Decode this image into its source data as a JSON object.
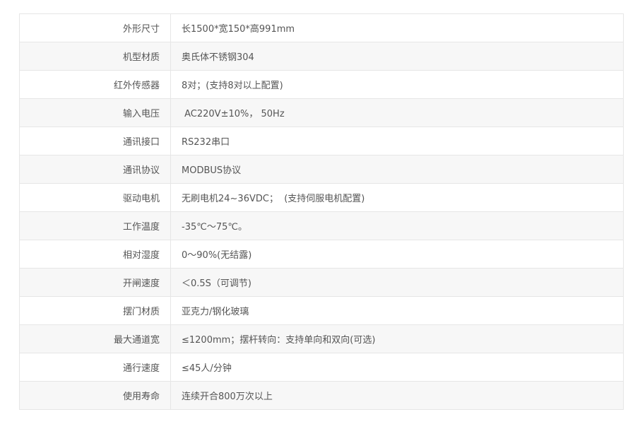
{
  "specs": [
    {
      "label": "外形尺寸",
      "value": "长1500*宽150*高991mm"
    },
    {
      "label": "机型材质",
      "value": "奥氏体不锈钢304"
    },
    {
      "label": "红外传感器",
      "value": "8对；(支持8对以上配置)"
    },
    {
      "label": "输入电压",
      "value": " AC220V±10%， 50Hz"
    },
    {
      "label": "通讯接口",
      "value": "RS232串口"
    },
    {
      "label": "通讯协议",
      "value": "MODBUS协议"
    },
    {
      "label": "驱动电机",
      "value": "无刷电机24~36VDC；  (支持伺服电机配置)"
    },
    {
      "label": "工作温度",
      "value": "-35℃～75℃。"
    },
    {
      "label": "相对湿度",
      "value": "0～90%(无结露)"
    },
    {
      "label": "开闸速度",
      "value": "＜0.5S（可调节)"
    },
    {
      "label": "摆门材质",
      "value": "亚克力/钢化玻璃"
    },
    {
      "label": "最大通道宽",
      "value": "≤1200mm；摆杆转向：支持单向和双向(可选)"
    },
    {
      "label": "通行速度",
      "value": "≤45人/分钟"
    },
    {
      "label": "使用寿命",
      "value": "连续开合800万次以上"
    }
  ]
}
